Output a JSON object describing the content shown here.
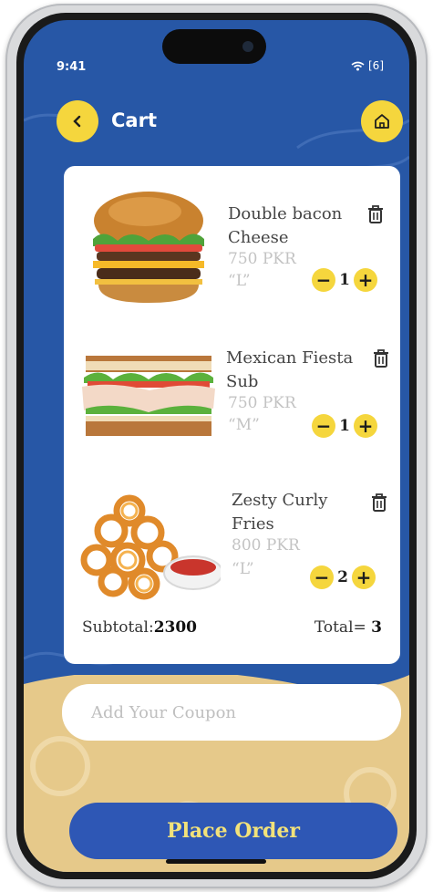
{
  "status_bar": {
    "time": "9:41",
    "battery": "[6]"
  },
  "header": {
    "back_icon": "chevron-left-icon",
    "title": "Cart",
    "home_icon": "home-icon"
  },
  "cart": {
    "items": [
      {
        "name": "Double bacon Cheese",
        "price": "750 PKR",
        "size": "“L”",
        "quantity": "1",
        "image": "burger"
      },
      {
        "name": "Mexican Fiesta Sub",
        "price": "750 PKR",
        "size": "“M”",
        "quantity": "1",
        "image": "sandwich"
      },
      {
        "name": "Zesty Curly Fries",
        "price": "800 PKR",
        "size": "“L”",
        "quantity": "2",
        "image": "curly-fries"
      }
    ],
    "subtotal_label": "Subtotal:",
    "subtotal_value": "2300",
    "total_label": "Total= ",
    "total_value": "3"
  },
  "coupon": {
    "placeholder": "Add Your Coupon",
    "value": ""
  },
  "actions": {
    "place_order_label": "Place Order"
  },
  "colors": {
    "primary_blue": "#2757a6",
    "button_blue": "#2e57b5",
    "accent_yellow": "#f5d63d",
    "sand": "#e6c98a"
  }
}
